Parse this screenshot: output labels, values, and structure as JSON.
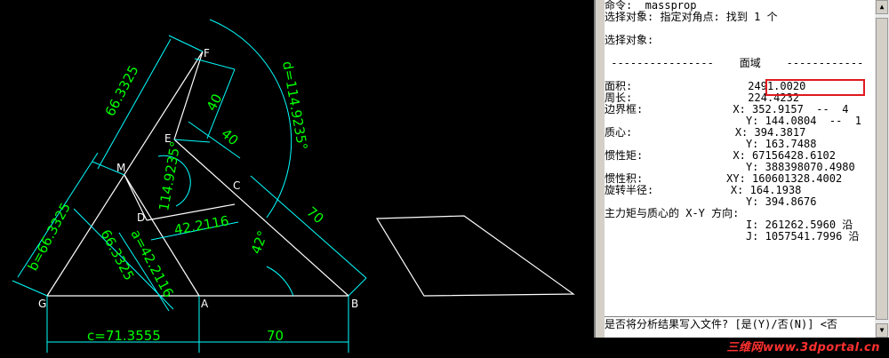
{
  "drawing": {
    "labels": {
      "dim_fm": "66.3325",
      "dim_b": "b=66.3325",
      "dim_mg": "66.3325",
      "dim_a": "a=42.2116",
      "dim_dc": "42.2116",
      "dim_ecircle": "114.9235°",
      "dim_d": "d=114.9235°",
      "dim_40a": "40",
      "dim_40b": "40",
      "dim_70a": "70",
      "dim_70b": "70",
      "dim_c": "c=71.3555",
      "dim_42": "42°",
      "pt_F": "F",
      "pt_E": "E",
      "pt_M": "M",
      "pt_C": "C",
      "pt_D": "D",
      "pt_G": "G",
      "pt_A": "A",
      "pt_B": "B"
    }
  },
  "command": {
    "lines": [
      "命令: _massprop",
      "选择对象: 指定对角点: 找到 1 个",
      "",
      "选择对象:",
      "",
      " ----------------    面域    ------------",
      "",
      "面积:                  2491.0020",
      "周长:                  224.4232",
      "边界框:              X: 352.9157  --  4",
      "                      Y: 144.0804  --  1",
      "质心:                X: 394.3817",
      "                      Y: 163.7488",
      "惯性矩:              X: 67156428.6102",
      "                      Y: 388398070.4980",
      "惯性积:             XY: 160601328.4002",
      "旋转半径:            X: 164.1938",
      "                      Y: 394.8676",
      "主力矩与质心的 X-Y 方向:",
      "                      I: 261262.5960 沿",
      "                      J: 1057541.7996 沿"
    ],
    "prompt": "是否将分析结果写入文件? [是(Y)/否(N)] <否"
  },
  "watermark": "三维网www.3dportal.cn",
  "colors": {
    "line": "#ffffff",
    "dim": "#00ff00",
    "dimline": "#00ffff",
    "highlight": "#e0191e"
  }
}
